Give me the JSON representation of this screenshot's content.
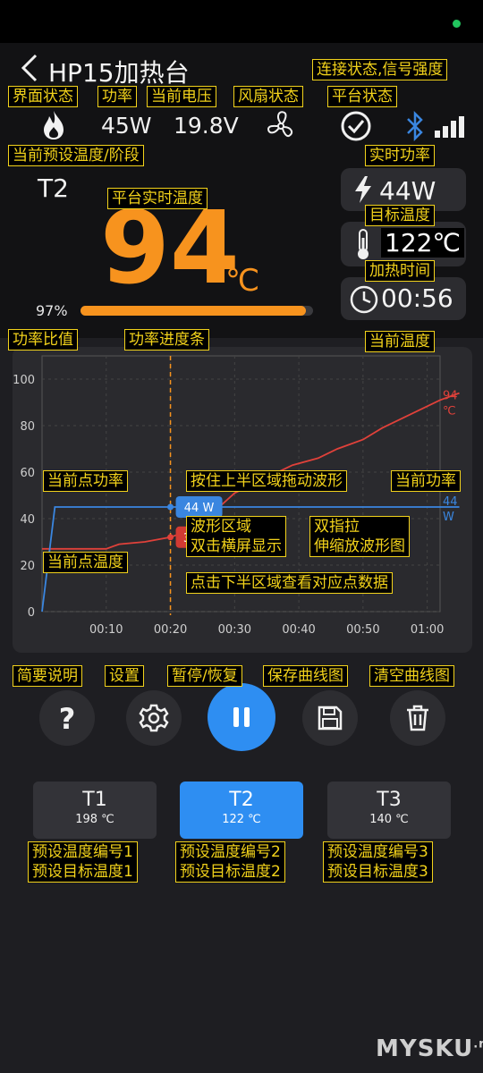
{
  "header": {
    "back": "<",
    "title": "HP15加热台"
  },
  "status": {
    "power": "45W",
    "voltage": "19.8V"
  },
  "preset": "T2",
  "temp": {
    "value": "94",
    "unit": "℃"
  },
  "ratio": {
    "text": "97%",
    "fraction": 0.97
  },
  "right": {
    "power": "44W",
    "target": "122℃",
    "time": "00:56"
  },
  "chart_data": {
    "type": "line",
    "x_ticks": [
      "00:10",
      "00:20",
      "00:30",
      "00:40",
      "00:50",
      "01:00"
    ],
    "y_ticks": [
      "0",
      "20",
      "40",
      "60",
      "80",
      "100"
    ],
    "ylim": [
      0,
      110
    ],
    "xlim": [
      0,
      62
    ],
    "cursor_x": 20,
    "series": [
      {
        "color": "#e0413a",
        "end_label": "94 ℃",
        "points": [
          [
            0,
            27
          ],
          [
            10,
            27
          ],
          [
            12,
            29
          ],
          [
            16,
            30
          ],
          [
            20,
            32
          ],
          [
            22,
            34
          ],
          [
            25,
            40
          ],
          [
            28,
            46
          ],
          [
            30,
            51
          ],
          [
            33,
            55
          ],
          [
            36,
            59
          ],
          [
            39,
            63
          ],
          [
            43,
            66
          ],
          [
            46,
            70
          ],
          [
            50,
            74
          ],
          [
            53,
            79
          ],
          [
            56,
            83
          ],
          [
            59,
            87
          ],
          [
            62,
            91
          ],
          [
            65,
            94
          ]
        ]
      },
      {
        "color": "#3a86e0",
        "end_label": "44 W",
        "points": [
          [
            0,
            0
          ],
          [
            2,
            45
          ],
          [
            20,
            45
          ],
          [
            65,
            45
          ]
        ]
      }
    ],
    "tooltip_power": "44 W",
    "tooltip_temp": "32 ℃"
  },
  "presets": [
    {
      "name": "T1",
      "temp": "198 ℃",
      "active": false
    },
    {
      "name": "T2",
      "temp": "122 ℃",
      "active": true
    },
    {
      "name": "T3",
      "temp": "140 ℃",
      "active": false
    }
  ],
  "annotations": {
    "conn": "连接状态,信号强度",
    "ui": "界面状态",
    "power": "功率",
    "voltage": "当前电压",
    "fan": "风扇状态",
    "platform": "平台状态",
    "preset": "当前预设温度/阶段",
    "realpower": "实时功率",
    "realtemp": "平台实时温度",
    "target": "目标温度",
    "heattime": "加热时间",
    "ratio": "功率比值",
    "progress": "功率进度条",
    "curtemp": "当前温度",
    "ptpower": "当前点功率",
    "drag": "按住上半区域拖动波形",
    "curpower": "当前功率",
    "wave": "波形区域\n双击横屏显示",
    "pinch": "双指拉\n伸缩放波形图",
    "pttemp": "当前点温度",
    "tapdata": "点击下半区域查看对应点数据",
    "help": "简要说明",
    "settings": "设置",
    "pause": "暂停/恢复",
    "save": "保存曲线图",
    "clear": "清空曲线图",
    "p1": "预设温度编号1\n预设目标温度1",
    "p2": "预设温度编号2\n预设目标温度2",
    "p3": "预设温度编号3\n预设目标温度3"
  },
  "watermark": {
    "text": "MYSKU",
    "sup": ".ru"
  }
}
